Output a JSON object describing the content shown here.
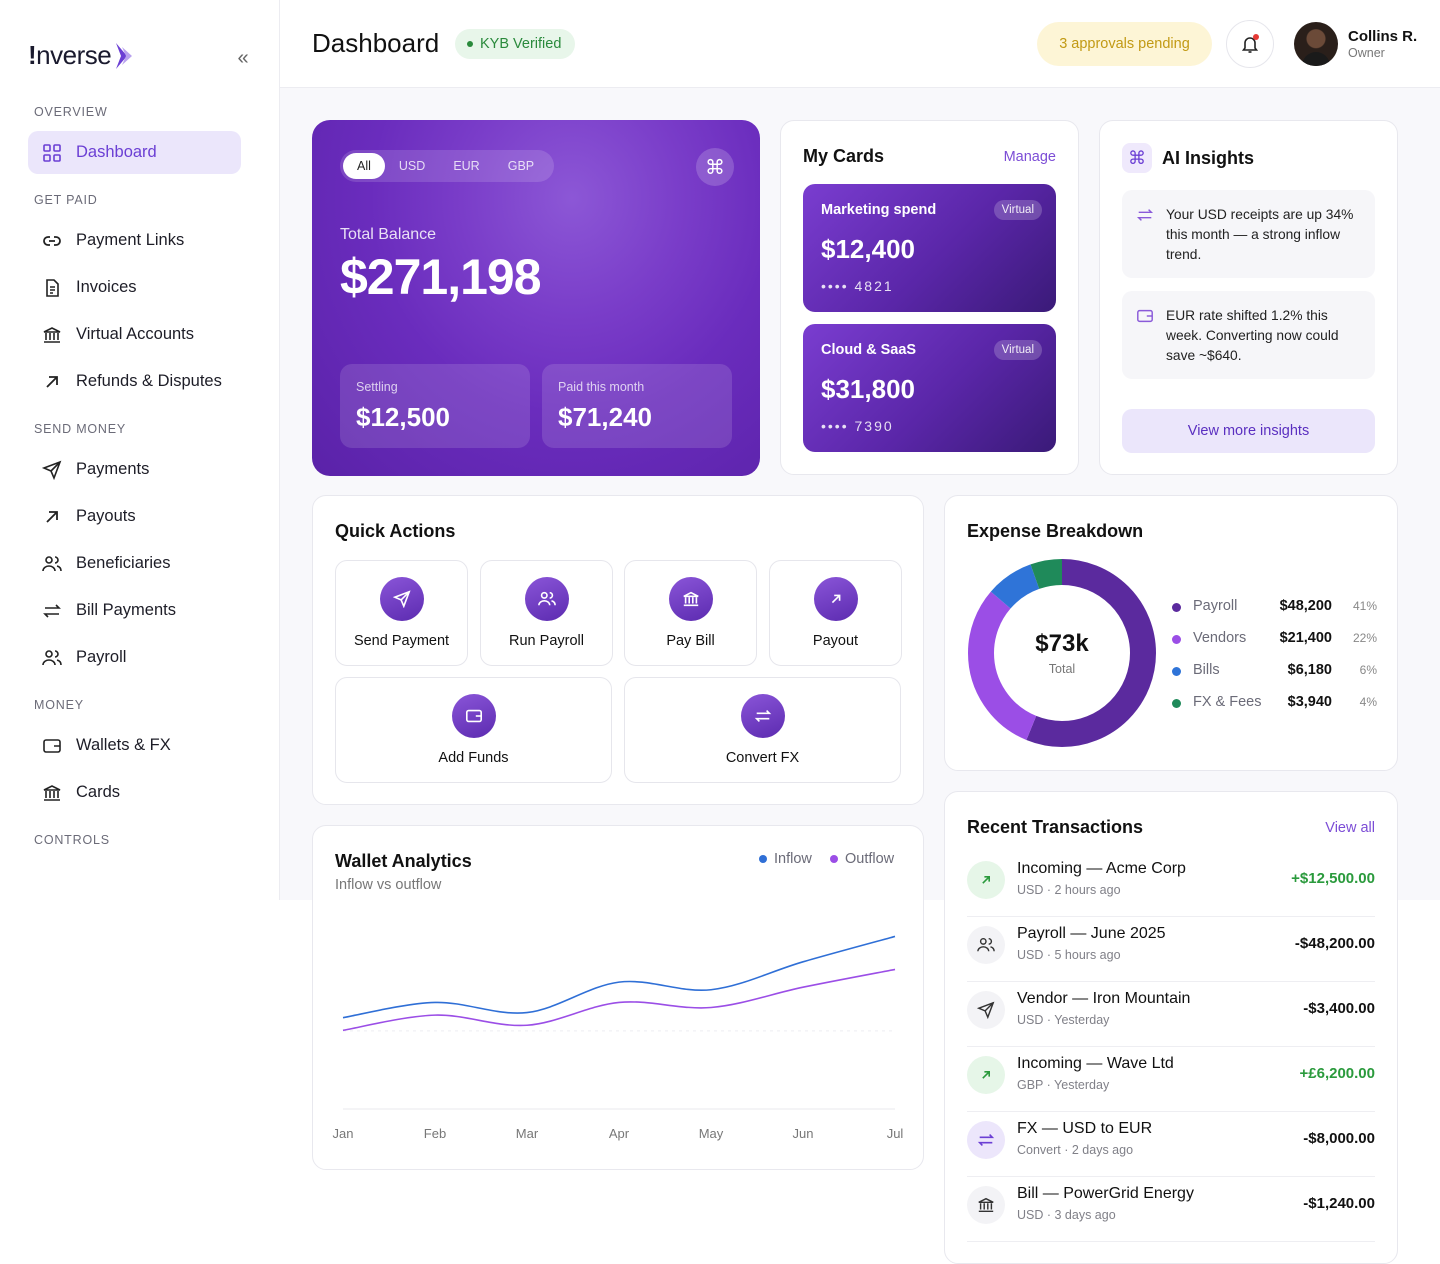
{
  "brand": {
    "name": "nverse",
    "prefix": "!"
  },
  "sidebar": {
    "sections": [
      {
        "label": "OVERVIEW"
      },
      {
        "label": "GET PAID"
      },
      {
        "label": "SEND MONEY"
      },
      {
        "label": "MONEY"
      },
      {
        "label": "CONTROLS"
      }
    ],
    "items": [
      {
        "label": "Dashboard",
        "icon": "grid-icon"
      },
      {
        "label": "Payment Links",
        "icon": "link-icon"
      },
      {
        "label": "Invoices",
        "icon": "document-icon"
      },
      {
        "label": "Virtual Accounts",
        "icon": "bank-icon"
      },
      {
        "label": "Refunds & Disputes",
        "icon": "arrow-up-right-icon"
      },
      {
        "label": "Payments",
        "icon": "send-icon"
      },
      {
        "label": "Payouts",
        "icon": "arrow-up-right-icon"
      },
      {
        "label": "Beneficiaries",
        "icon": "users-icon"
      },
      {
        "label": "Bill Payments",
        "icon": "swap-icon"
      },
      {
        "label": "Payroll",
        "icon": "users-icon"
      },
      {
        "label": "Wallets & FX",
        "icon": "wallet-icon"
      },
      {
        "label": "Cards",
        "icon": "bank-icon"
      }
    ]
  },
  "header": {
    "title": "Dashboard",
    "kyb": "KYB Verified",
    "approvals": "3  approvals pending",
    "user_name": "Collins R.",
    "user_role": "Owner"
  },
  "balance": {
    "tabs": [
      "All",
      "USD",
      "EUR",
      "GBP"
    ],
    "selected_tab": "All",
    "label": "Total Balance",
    "value": "$271,198",
    "settling_label": "Settling",
    "settling_value": "$12,500",
    "paid_label": "Paid this month",
    "paid_value": "$71,240"
  },
  "my_cards": {
    "title": "My Cards",
    "manage": "Manage",
    "cards": [
      {
        "name": "Marketing spend",
        "badge": "Virtual",
        "value": "$12,400",
        "digits": "•••• 4821"
      },
      {
        "name": "Cloud & SaaS",
        "badge": "Virtual",
        "value": "$31,800",
        "digits": "•••• 7390"
      }
    ]
  },
  "ai": {
    "title": "AI Insights",
    "insights": [
      {
        "text": "Your USD receipts are up 34% this month — a strong inflow trend."
      },
      {
        "text": "EUR rate shifted 1.2% this week. Converting now could save ~$640."
      }
    ],
    "more": "View more insights"
  },
  "quick_actions": {
    "title": "Quick Actions",
    "actions": [
      {
        "label": "Send Payment",
        "icon": "send-icon"
      },
      {
        "label": "Run Payroll",
        "icon": "users-icon"
      },
      {
        "label": "Pay Bill",
        "icon": "bank-icon"
      },
      {
        "label": "Payout",
        "icon": "arrow-up-right-icon"
      },
      {
        "label": "Add Funds",
        "icon": "wallet-icon"
      },
      {
        "label": "Convert FX",
        "icon": "swap-icon"
      }
    ]
  },
  "expense": {
    "title": "Expense Breakdown",
    "center_value": "$73k",
    "center_label": "Total",
    "items": [
      {
        "name": "Payroll",
        "value": "$48,200",
        "pct": "41%",
        "color": "#5b2a9e",
        "share": 41
      },
      {
        "name": "Vendors",
        "value": "$21,400",
        "pct": "22%",
        "color": "#9b4ee6",
        "share": 22
      },
      {
        "name": "Bills",
        "value": "$6,180",
        "pct": "6%",
        "color": "#2f74d8",
        "share": 6
      },
      {
        "name": "FX & Fees",
        "value": "$3,940",
        "pct": "4%",
        "color": "#1f8a5a",
        "share": 4
      }
    ]
  },
  "transactions": {
    "title": "Recent Transactions",
    "view_all": "View all",
    "rows": [
      {
        "name": "Incoming — Acme Corp",
        "sub": "USD · 2 hours ago",
        "amount": "+$12,500.00",
        "icon": "arrow-up-right-icon",
        "positive": true
      },
      {
        "name": "Payroll — June 2025",
        "sub": "USD · 5 hours ago",
        "amount": "-$48,200.00",
        "icon": "users-icon",
        "positive": false
      },
      {
        "name": "Vendor — Iron Mountain",
        "sub": "USD · Yesterday",
        "amount": "-$3,400.00",
        "icon": "send-icon",
        "positive": false
      },
      {
        "name": "Incoming — Wave Ltd",
        "sub": "GBP · Yesterday",
        "amount": "+£6,200.00",
        "icon": "arrow-up-right-icon",
        "positive": true
      },
      {
        "name": "FX — USD to EUR",
        "sub": "Convert · 2 days ago",
        "amount": "-$8,000.00",
        "icon": "swap-icon",
        "positive": false
      },
      {
        "name": "Bill — PowerGrid Energy",
        "sub": "USD · 3 days ago",
        "amount": "-$1,240.00",
        "icon": "bank-icon",
        "positive": false
      }
    ]
  },
  "analytics": {
    "title": "Wallet Analytics",
    "subtitle": "Inflow vs outflow",
    "legend_inflow": "Inflow",
    "legend_outflow": "Outflow"
  },
  "chart_data": {
    "type": "line",
    "categories": [
      "Jan",
      "Feb",
      "Mar",
      "Apr",
      "May",
      "Jun",
      "Jul"
    ],
    "series": [
      {
        "name": "Inflow",
        "color": "#2f6fd6",
        "values": [
          36,
          42,
          38,
          50,
          47,
          58,
          68
        ]
      },
      {
        "name": "Outflow",
        "color": "#9b4ee6",
        "values": [
          31,
          37,
          33,
          42,
          40,
          48,
          55
        ]
      }
    ],
    "ylim": [
      0,
      80
    ],
    "grid": false
  }
}
